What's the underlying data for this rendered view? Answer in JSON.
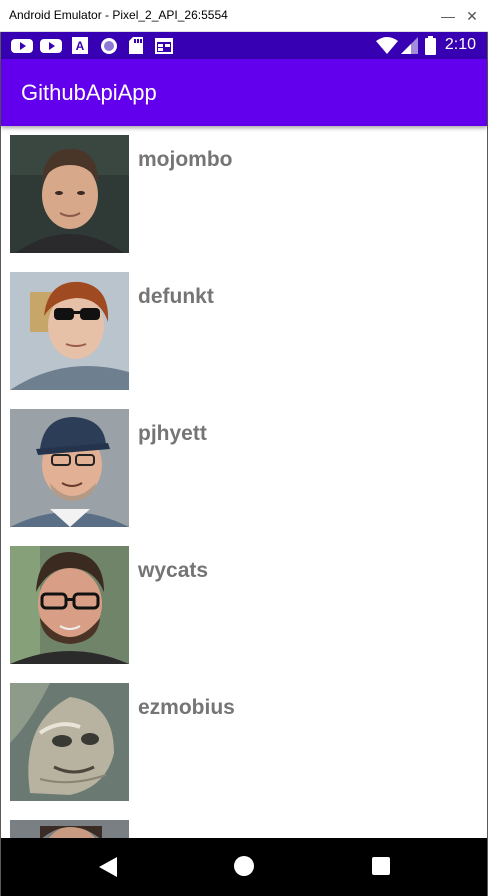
{
  "window": {
    "title": "Android Emulator - Pixel_2_API_26:5554",
    "close_glyph": "✕"
  },
  "status_bar": {
    "time": "2:10",
    "notification_icons": [
      "youtube-icon",
      "youtube-icon",
      "font-app-icon",
      "circle-app-icon",
      "sd-card-icon",
      "calendar-icon"
    ],
    "system_icons": [
      "wifi-icon",
      "signal-icon",
      "battery-icon"
    ]
  },
  "app_bar": {
    "title": "GithubApiApp"
  },
  "users": [
    {
      "login": "mojombo"
    },
    {
      "login": "defunkt"
    },
    {
      "login": "pjhyett"
    },
    {
      "login": "wycats"
    },
    {
      "login": "ezmobius"
    }
  ],
  "nav_bar": {
    "buttons": [
      "back-icon",
      "home-icon",
      "recents-icon"
    ]
  },
  "colors": {
    "status_bar": "#3700b3",
    "app_bar": "#6200ee",
    "username_text": "#757575",
    "nav_bar": "#000000"
  }
}
